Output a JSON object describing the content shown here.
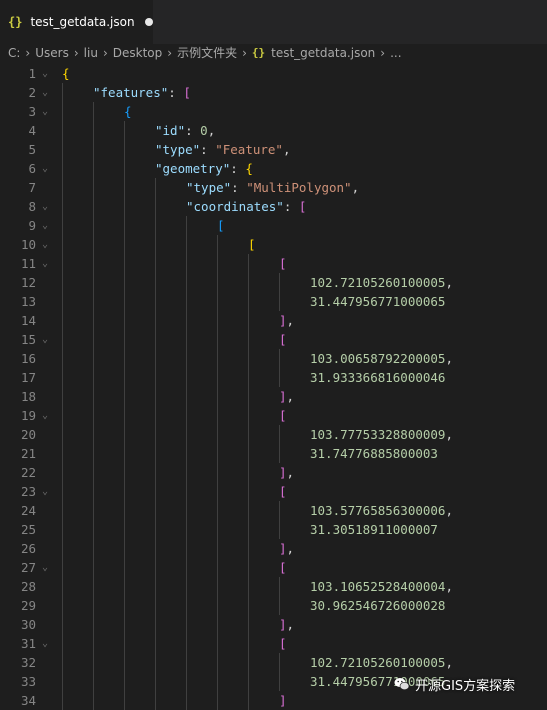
{
  "tab": {
    "icon": "{}",
    "label": "test_getdata.json"
  },
  "breadcrumb": {
    "parts": [
      "C:",
      "Users",
      "liu",
      "Desktop",
      "示例文件夹"
    ],
    "file_icon": "{}",
    "file": "test_getdata.json",
    "trailing": "..."
  },
  "lines": [
    {
      "n": 1,
      "fold": true,
      "segs": [
        [
          "{",
          "b-gold"
        ]
      ]
    },
    {
      "n": 2,
      "fold": true,
      "segs": [
        [
          "\"features\"",
          "tok-key"
        ],
        [
          ": ",
          "tok-p"
        ],
        [
          "[",
          "b-pink"
        ]
      ]
    },
    {
      "n": 3,
      "fold": true,
      "segs": [
        [
          "{",
          "b-blue"
        ]
      ]
    },
    {
      "n": 4,
      "fold": false,
      "segs": [
        [
          "\"id\"",
          "tok-key"
        ],
        [
          ": ",
          "tok-p"
        ],
        [
          "0",
          "tok-num"
        ],
        [
          ",",
          "tok-p"
        ]
      ]
    },
    {
      "n": 5,
      "fold": false,
      "segs": [
        [
          "\"type\"",
          "tok-key"
        ],
        [
          ": ",
          "tok-p"
        ],
        [
          "\"Feature\"",
          "tok-str"
        ],
        [
          ",",
          "tok-p"
        ]
      ]
    },
    {
      "n": 6,
      "fold": true,
      "segs": [
        [
          "\"geometry\"",
          "tok-key"
        ],
        [
          ": ",
          "tok-p"
        ],
        [
          "{",
          "b-gold"
        ]
      ]
    },
    {
      "n": 7,
      "fold": false,
      "segs": [
        [
          "\"type\"",
          "tok-key"
        ],
        [
          ": ",
          "tok-p"
        ],
        [
          "\"MultiPolygon\"",
          "tok-str"
        ],
        [
          ",",
          "tok-p"
        ]
      ]
    },
    {
      "n": 8,
      "fold": true,
      "segs": [
        [
          "\"coordinates\"",
          "tok-key"
        ],
        [
          ": ",
          "tok-p"
        ],
        [
          "[",
          "b-pink"
        ]
      ]
    },
    {
      "n": 9,
      "fold": true,
      "segs": [
        [
          "[",
          "b-blue"
        ]
      ]
    },
    {
      "n": 10,
      "fold": true,
      "segs": [
        [
          "[",
          "b-gold"
        ]
      ]
    },
    {
      "n": 11,
      "fold": true,
      "segs": [
        [
          "[",
          "b-pink"
        ]
      ]
    },
    {
      "n": 12,
      "fold": false,
      "segs": [
        [
          "102.72105260100005",
          "tok-num"
        ],
        [
          ",",
          "tok-p"
        ]
      ]
    },
    {
      "n": 13,
      "fold": false,
      "segs": [
        [
          "31.447956771000065",
          "tok-num"
        ]
      ]
    },
    {
      "n": 14,
      "fold": false,
      "segs": [
        [
          "]",
          "b-pink"
        ],
        [
          ",",
          "tok-p"
        ]
      ]
    },
    {
      "n": 15,
      "fold": true,
      "segs": [
        [
          "[",
          "b-pink"
        ]
      ]
    },
    {
      "n": 16,
      "fold": false,
      "segs": [
        [
          "103.00658792200005",
          "tok-num"
        ],
        [
          ",",
          "tok-p"
        ]
      ]
    },
    {
      "n": 17,
      "fold": false,
      "segs": [
        [
          "31.933366816000046",
          "tok-num"
        ]
      ]
    },
    {
      "n": 18,
      "fold": false,
      "segs": [
        [
          "]",
          "b-pink"
        ],
        [
          ",",
          "tok-p"
        ]
      ]
    },
    {
      "n": 19,
      "fold": true,
      "segs": [
        [
          "[",
          "b-pink"
        ]
      ]
    },
    {
      "n": 20,
      "fold": false,
      "segs": [
        [
          "103.77753328800009",
          "tok-num"
        ],
        [
          ",",
          "tok-p"
        ]
      ]
    },
    {
      "n": 21,
      "fold": false,
      "segs": [
        [
          "31.74776885800003",
          "tok-num"
        ]
      ]
    },
    {
      "n": 22,
      "fold": false,
      "segs": [
        [
          "]",
          "b-pink"
        ],
        [
          ",",
          "tok-p"
        ]
      ]
    },
    {
      "n": 23,
      "fold": true,
      "segs": [
        [
          "[",
          "b-pink"
        ]
      ]
    },
    {
      "n": 24,
      "fold": false,
      "segs": [
        [
          "103.57765856300006",
          "tok-num"
        ],
        [
          ",",
          "tok-p"
        ]
      ]
    },
    {
      "n": 25,
      "fold": false,
      "segs": [
        [
          "31.30518911000007",
          "tok-num"
        ]
      ]
    },
    {
      "n": 26,
      "fold": false,
      "segs": [
        [
          "]",
          "b-pink"
        ],
        [
          ",",
          "tok-p"
        ]
      ]
    },
    {
      "n": 27,
      "fold": true,
      "segs": [
        [
          "[",
          "b-pink"
        ]
      ]
    },
    {
      "n": 28,
      "fold": false,
      "segs": [
        [
          "103.10652528400004",
          "tok-num"
        ],
        [
          ",",
          "tok-p"
        ]
      ]
    },
    {
      "n": 29,
      "fold": false,
      "segs": [
        [
          "30.962546726000028",
          "tok-num"
        ]
      ]
    },
    {
      "n": 30,
      "fold": false,
      "segs": [
        [
          "]",
          "b-pink"
        ],
        [
          ",",
          "tok-p"
        ]
      ]
    },
    {
      "n": 31,
      "fold": true,
      "segs": [
        [
          "[",
          "b-pink"
        ]
      ]
    },
    {
      "n": 32,
      "fold": false,
      "segs": [
        [
          "102.72105260100005",
          "tok-num"
        ],
        [
          ",",
          "tok-p"
        ]
      ]
    },
    {
      "n": 33,
      "fold": false,
      "segs": [
        [
          "31.447956771000065",
          "tok-num"
        ]
      ]
    },
    {
      "n": 34,
      "fold": false,
      "segs": [
        [
          "]",
          "b-pink"
        ]
      ]
    }
  ],
  "watermark": {
    "text": "开源GIS方案探索"
  },
  "colors": {
    "background": "#1e1e1e",
    "key": "#9cdcfe",
    "string": "#ce9178",
    "number": "#b5cea8",
    "bracket_gold": "#ffd700",
    "bracket_pink": "#da70d6",
    "bracket_blue": "#179fff"
  }
}
